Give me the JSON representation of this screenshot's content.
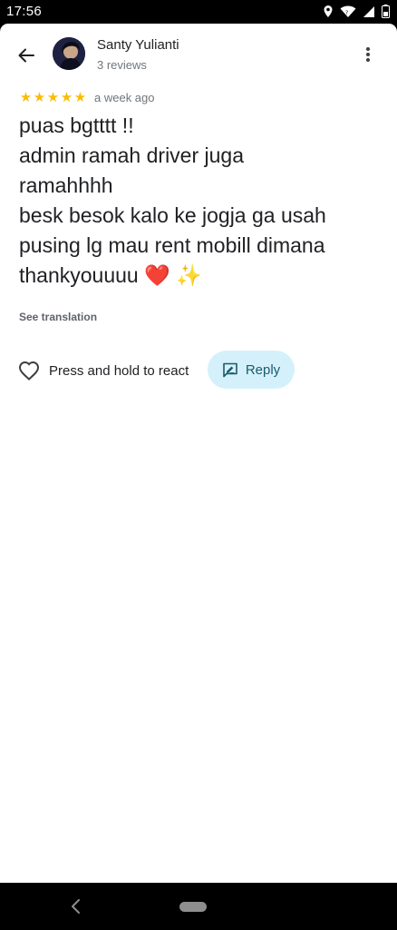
{
  "status_bar": {
    "time": "17:56",
    "icons": [
      "location-icon",
      "wifi-icon",
      "signal-icon",
      "battery-icon"
    ]
  },
  "header": {
    "back_icon": "arrow-left-icon",
    "user_name": "Santy Yulianti",
    "reviews_count": "3 reviews",
    "more_icon": "more-vert-icon"
  },
  "review": {
    "rating": 5,
    "rating_max": 5,
    "time_ago": "a week ago",
    "text_lines": [
      "puas bgtttt !!",
      "admin ramah driver juga",
      "ramahhhh",
      "besk besok kalo ke jogja ga usah",
      "pusing lg mau rent mobill dimana",
      "thankyouuuu"
    ],
    "emoji_heart": "❤️",
    "emoji_sparkles": "✨",
    "see_translation": "See translation"
  },
  "actions": {
    "react_label": "Press and hold to react",
    "reply_label": "Reply"
  },
  "colors": {
    "star": "#fbbc04",
    "reply_bg": "#d4f1fb",
    "reply_text": "#1b5a6c"
  }
}
